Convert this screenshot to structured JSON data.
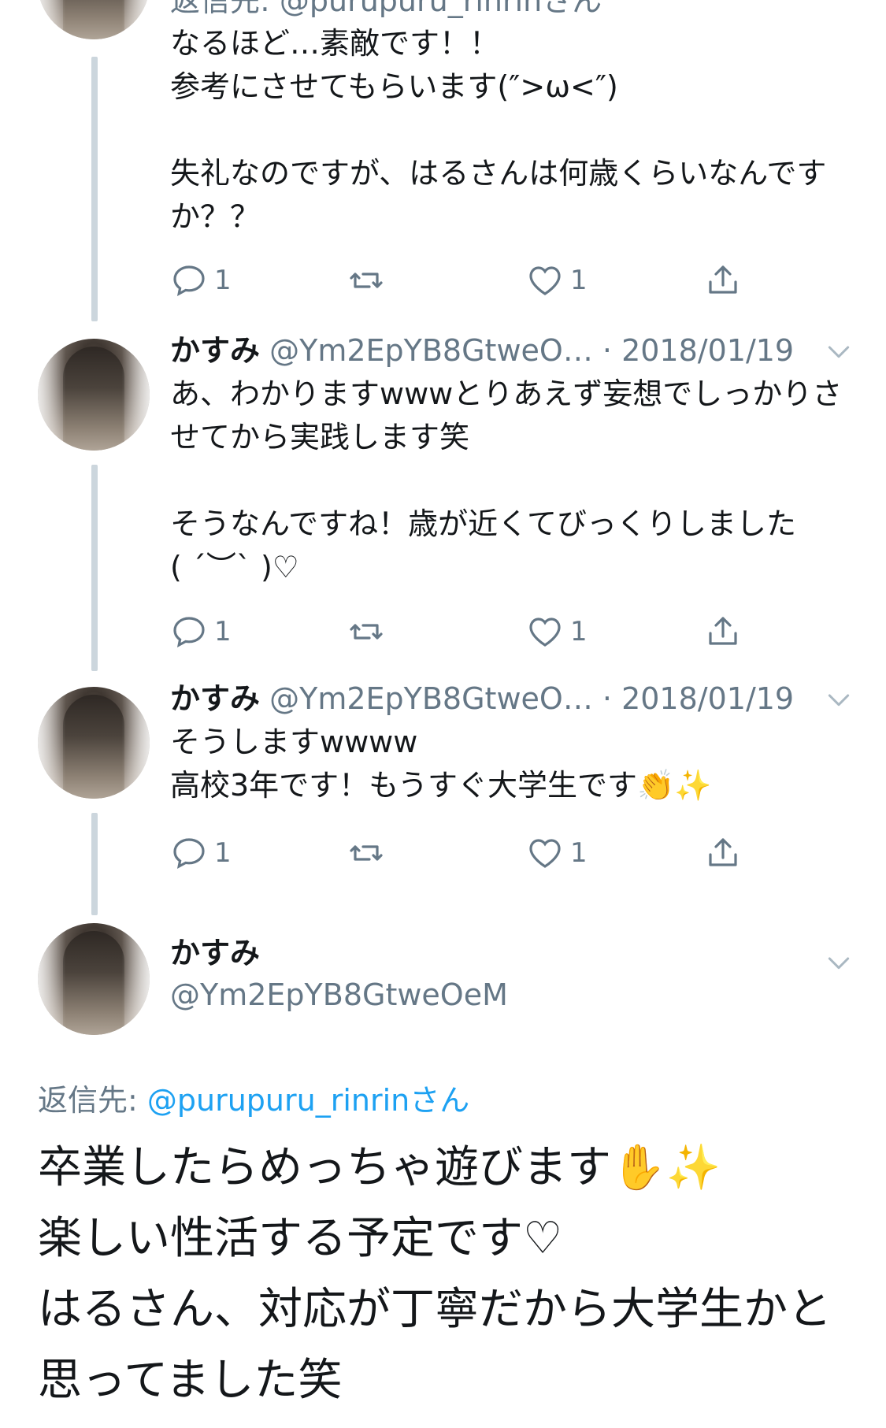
{
  "top_partial_reply_text": "返信先: @purupuru_rinrinさん",
  "tweets": [
    {
      "text": "なるほど…素敵です！！\n参考にさせてもらいます(″>ω<″)\n\n失礼なのですが、はるさんは何歳くらいなんですか？？",
      "reply_count": "1",
      "like_count": "1"
    },
    {
      "name": "かすみ",
      "handle": "@Ym2EpYB8GtweO…",
      "date": "· 2018/01/19",
      "text": "あ、わかりますwwwとりあえず妄想でしっかりさせてから実践します笑\n\nそうなんですね！歳が近くてびっくりしました\n( ´︶` )♡",
      "reply_count": "1",
      "like_count": "1"
    },
    {
      "name": "かすみ",
      "handle": "@Ym2EpYB8GtweO…",
      "date": "· 2018/01/19",
      "text": "そうしますwwww\n高校3年です！もうすぐ大学生です👏✨",
      "reply_count": "1",
      "like_count": "1"
    }
  ],
  "main_tweet": {
    "name": "かすみ",
    "handle": "@Ym2EpYB8GtweOeM",
    "reply_to_label": "返信先: ",
    "reply_to_user": "@purupuru_rinrinさん",
    "text": "卒業したらめっちゃ遊びます✋✨\n楽しい性活する予定です♡\nはるさん、対応が丁寧だから大学生かと思ってました笑"
  },
  "icons": {
    "reply": "reply-icon",
    "retweet": "retweet-icon",
    "like": "heart-icon",
    "share": "share-icon",
    "menu": "chevron-down-icon"
  },
  "colors": {
    "text": "#14171a",
    "secondary": "#657786",
    "link": "#1da1f2",
    "thread_line": "#ccd6dd"
  }
}
